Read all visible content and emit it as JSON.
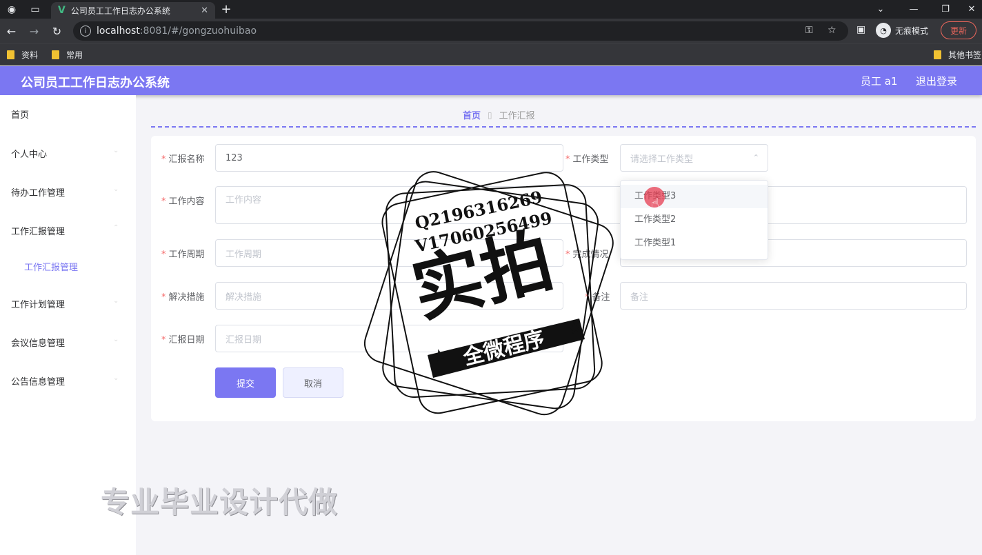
{
  "browser": {
    "tab_title": "公司员工工作日志办公系统",
    "url_host": "localhost",
    "url_path": ":8081/#/gongzuohuibao",
    "incognito_label": "无痕模式",
    "update_label": "更新",
    "bookmarks": [
      "资料",
      "常用"
    ],
    "other_bookmarks": "其他书签"
  },
  "header": {
    "title": "公司员工工作日志办公系统",
    "user": "员工 a1",
    "logout": "退出登录"
  },
  "sidebar": {
    "items": [
      "首页",
      "个人中心",
      "待办工作管理",
      "工作汇报管理",
      "工作计划管理",
      "会议信息管理",
      "公告信息管理"
    ],
    "subitem": "工作汇报管理"
  },
  "breadcrumb": {
    "home": "首页",
    "current": "工作汇报"
  },
  "form": {
    "report_name": {
      "label": "汇报名称",
      "value": "123"
    },
    "work_type": {
      "label": "工作类型",
      "placeholder": "请选择工作类型"
    },
    "work_content": {
      "label": "工作内容",
      "placeholder": "工作内容"
    },
    "work_period": {
      "label": "工作周期",
      "placeholder": "工作周期"
    },
    "completion": {
      "label": "完成情况"
    },
    "solution": {
      "label": "解决措施",
      "placeholder": "解决措施"
    },
    "remark": {
      "label": "备注",
      "placeholder": "备注"
    },
    "report_date": {
      "label": "汇报日期",
      "placeholder": "汇报日期"
    },
    "submit": "提交",
    "cancel": "取消"
  },
  "dropdown": {
    "options": [
      "工作类型3",
      "工作类型2",
      "工作类型1"
    ]
  },
  "watermark": {
    "line1": "Q2196316269",
    "line2": "V17060256499",
    "big": "实拍",
    "banner": "全微程序"
  },
  "promo": "专业毕业设计代做",
  "colors": {
    "accent": "#7b77f2",
    "required": "#f56c6c"
  }
}
